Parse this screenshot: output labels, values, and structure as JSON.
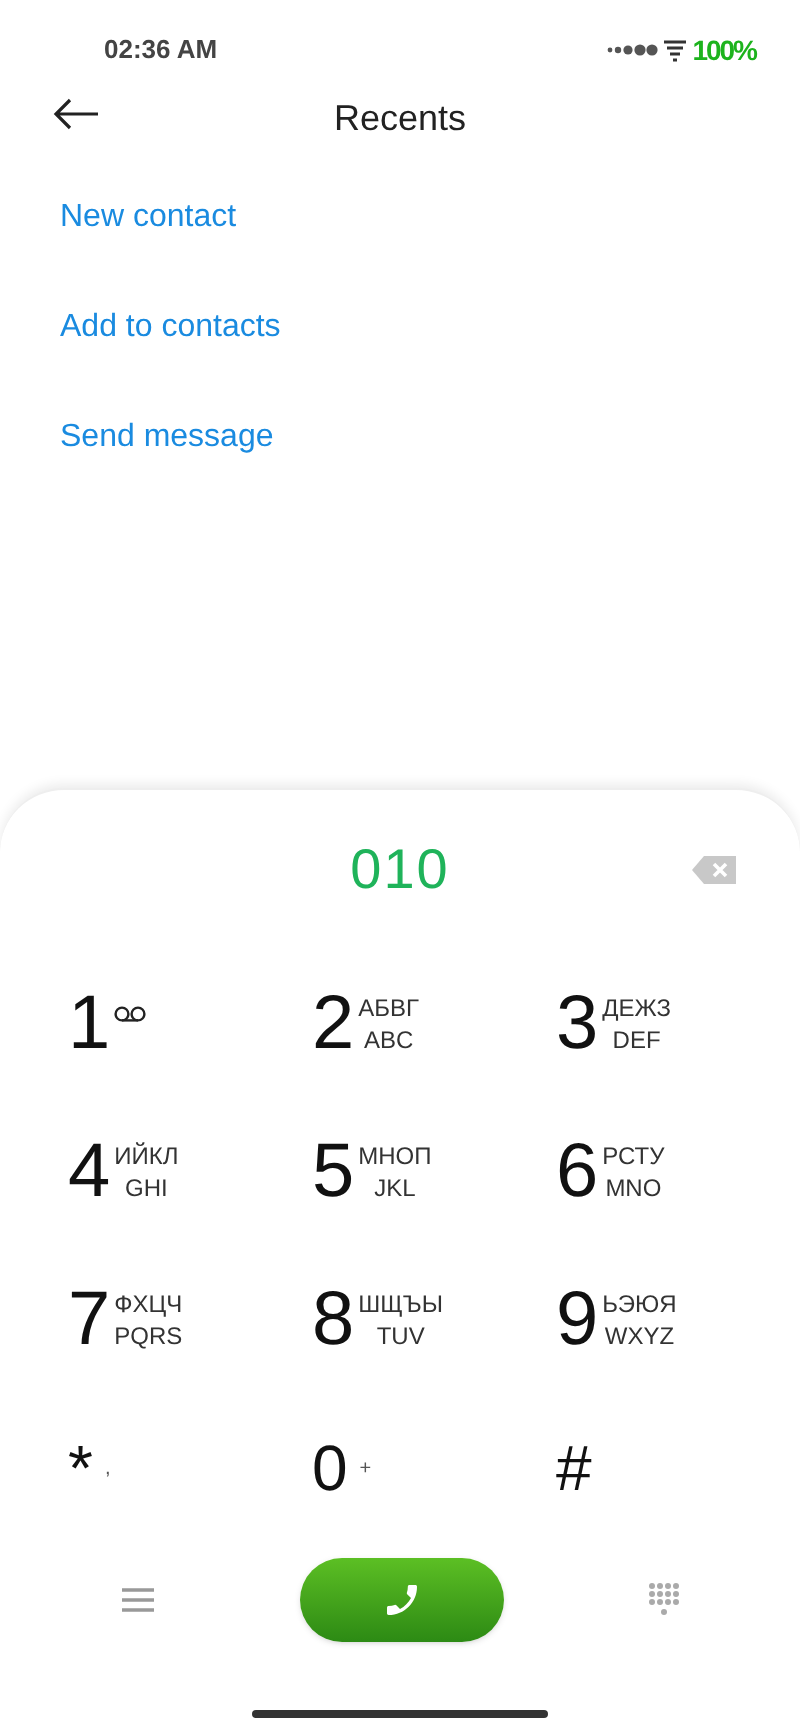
{
  "status_bar": {
    "time": "02:36 AM",
    "battery": "100%"
  },
  "header": {
    "title": "Recents"
  },
  "actions": [
    "New contact",
    "Add to contacts",
    "Send message"
  ],
  "dialer": {
    "number": "010",
    "keys": [
      {
        "digit": "1",
        "kind": "voicemail"
      },
      {
        "digit": "2",
        "kind": "letters",
        "line1": "АБВГ",
        "line2": "ABC"
      },
      {
        "digit": "3",
        "kind": "letters",
        "line1": "ДЕЖЗ",
        "line2": "DEF"
      },
      {
        "digit": "4",
        "kind": "letters",
        "line1": "ИЙКЛ",
        "line2": "GHI"
      },
      {
        "digit": "5",
        "kind": "letters",
        "line1": "МНОП",
        "line2": "JKL"
      },
      {
        "digit": "6",
        "kind": "letters",
        "line1": "РСТУ",
        "line2": "MNO"
      },
      {
        "digit": "7",
        "kind": "letters",
        "line1": "ФХЦЧ",
        "line2": "PQRS"
      },
      {
        "digit": "8",
        "kind": "letters",
        "line1": "ШЩЪЫ",
        "line2": "TUV"
      },
      {
        "digit": "9",
        "kind": "letters",
        "line1": "ЬЭЮЯ",
        "line2": "WXYZ"
      },
      {
        "digit": "*",
        "kind": "symbol",
        "line1": ","
      },
      {
        "digit": "0",
        "kind": "symbol",
        "line1": "+"
      },
      {
        "digit": "#",
        "kind": "plain"
      }
    ]
  }
}
